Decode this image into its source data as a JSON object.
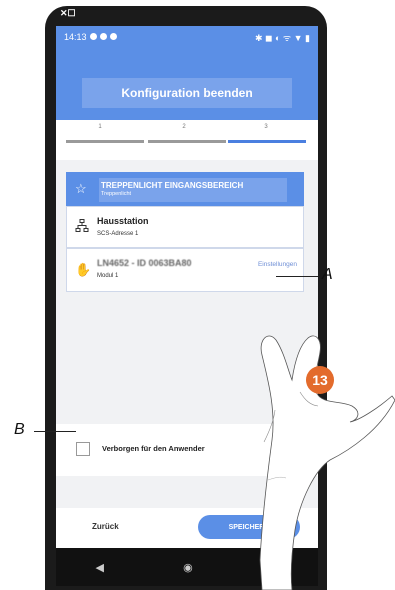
{
  "status": {
    "time": "14:13"
  },
  "appbar": {
    "title": "Konfiguration beenden"
  },
  "steps": [
    "1",
    "2",
    "3"
  ],
  "group": {
    "name": "TREPPENLICHT EINGANGSBEREICH",
    "type": "Treppenlicht"
  },
  "station": {
    "name": "Hausstation",
    "address": "SCS-Adresse 1"
  },
  "module": {
    "name": "LN4652 - ID 0063BA80",
    "sub": "Modul 1",
    "settings_label": "Einstellungen"
  },
  "hide": {
    "label": "Verborgen für den Anwender"
  },
  "bottom": {
    "back_label": "Zurück",
    "save_label": "SPEICHERN"
  },
  "annotations": {
    "a": "A",
    "b": "B",
    "step": "13"
  },
  "colors": {
    "accent": "#5b8fe6",
    "step_badge": "#e36b2c"
  }
}
